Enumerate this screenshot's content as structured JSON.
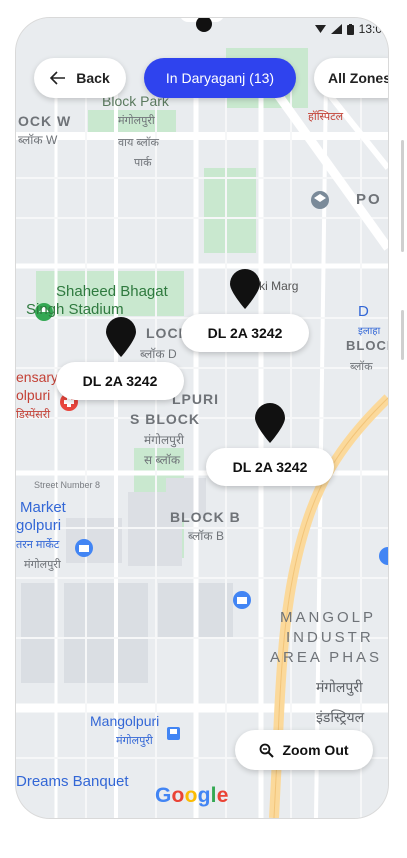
{
  "status_bar": {
    "time": "13:0"
  },
  "header": {
    "back_label": "Back",
    "zone_label": "In Daryaganj (13)",
    "all_zones_label": "All Zones"
  },
  "map": {
    "labels": [
      "Block Park",
      "OCK W",
      "ब्लॉक W",
      "मंगोलपुरी",
      "वाय ब्लॉक",
      "पार्क",
      "Shaheed Bhagat",
      "Singh Stadium",
      "Valmiki Marg",
      "BLOCK",
      "ब्लॉक",
      "LOCK",
      "ब्लॉक D",
      "ensary,",
      "olpuri",
      "डिस्पेंसरी",
      "LPURI",
      "S BLOCK",
      "मंगोलपुरी",
      "स ब्लॉक",
      "Street Number 8",
      "Market",
      "golpuri",
      "तरन मार्केट",
      "मंगोलपुरी",
      "BLOCK B",
      "ब्लॉक B",
      "MANGOLP",
      "INDUSTR",
      "AREA PHAS",
      "मंगोलपुरी",
      "इंडस्ट्रियल",
      "Mangolpuri",
      "मंगोलपुरी",
      "Dreams Banquet",
      "PO",
      "हॉस्पिटल",
      "इलाहा",
      "D"
    ]
  },
  "markers": [
    {
      "plate": "DL 2A 3242"
    },
    {
      "plate": "DL 2A 3242"
    },
    {
      "plate": "DL 2A 3242"
    }
  ],
  "zoom": {
    "label": "Zoom Out"
  },
  "attribution": {
    "google": "Google"
  },
  "colors": {
    "accent": "#2f43ee",
    "map_bg": "#e9ecef",
    "road": "#ffffff",
    "highway": "#fbd99b",
    "park": "#c9e8cf",
    "pin": "#111111"
  },
  "icons": [
    "arrow-left-icon",
    "search-icon",
    "wifi-icon",
    "signal-icon",
    "battery-icon",
    "map-pin-icon",
    "park-icon",
    "hospital-icon",
    "shopping-icon",
    "bus-icon",
    "dispensary-icon"
  ]
}
